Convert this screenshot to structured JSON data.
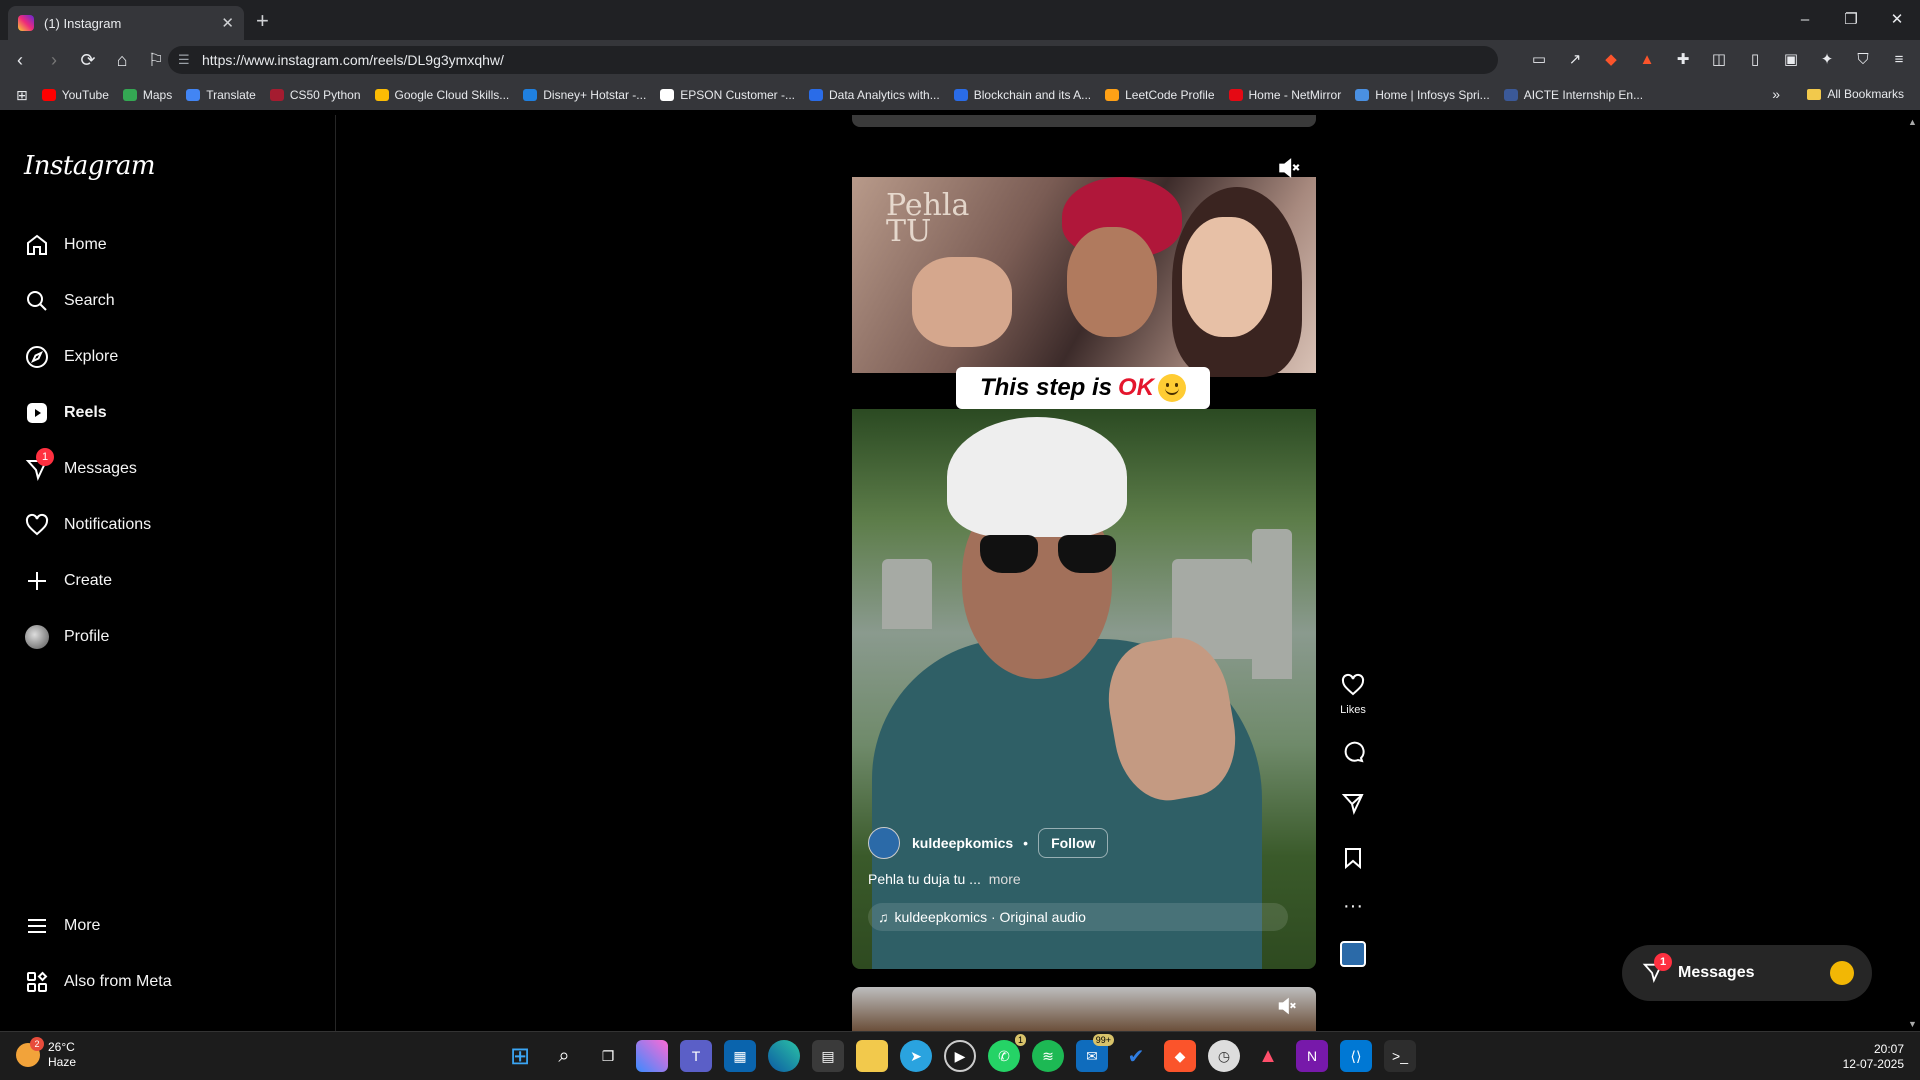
{
  "browser": {
    "tab_title": "(1) Instagram",
    "tab_close": "✕",
    "new_tab": "+",
    "url": "https://www.instagram.com/reels/DL9g3ymxqhw/",
    "window_controls": [
      "–",
      "❐",
      "✕"
    ]
  },
  "bookmarks": {
    "items": [
      {
        "label": "YouTube",
        "color": "#ff0000"
      },
      {
        "label": "Maps",
        "color": "#34a853"
      },
      {
        "label": "Translate",
        "color": "#4285f4"
      },
      {
        "label": "CS50 Python",
        "color": "#a51c30"
      },
      {
        "label": "Google Cloud Skills...",
        "color": "#fbbc04"
      },
      {
        "label": "Disney+ Hotstar -...",
        "color": "#1f80e0"
      },
      {
        "label": "EPSON Customer -...",
        "color": "#ffffff"
      },
      {
        "label": "Data Analytics with...",
        "color": "#2a6ce8"
      },
      {
        "label": "Blockchain and its A...",
        "color": "#2a6ce8"
      },
      {
        "label": "LeetCode Profile",
        "color": "#ffa116"
      },
      {
        "label": "Home - NetMirror",
        "color": "#e50914"
      },
      {
        "label": "Home | Infosys Spri...",
        "color": "#4a90e2"
      },
      {
        "label": "AICTE Internship En...",
        "color": "#3b5998"
      }
    ],
    "more": "»",
    "all_bookmarks": "All Bookmarks"
  },
  "sidebar": {
    "logo": "Instagram",
    "items": [
      {
        "label": "Home",
        "icon": "home-icon"
      },
      {
        "label": "Search",
        "icon": "search-icon"
      },
      {
        "label": "Explore",
        "icon": "compass-icon"
      },
      {
        "label": "Reels",
        "icon": "reels-icon"
      },
      {
        "label": "Messages",
        "icon": "messenger-icon",
        "badge": "1"
      },
      {
        "label": "Notifications",
        "icon": "heart-icon"
      },
      {
        "label": "Create",
        "icon": "plus-icon"
      },
      {
        "label": "Profile",
        "icon": "avatar-icon"
      }
    ],
    "more": "More",
    "also_from_meta": "Also from Meta"
  },
  "reel": {
    "song_overlay": "Pehla\nTU",
    "caption_text": "This step is",
    "caption_highlight": "OK",
    "username": "kuldeepkomics",
    "separator": "•",
    "follow": "Follow",
    "description": "Pehla tu duja tu ...",
    "more": "more",
    "audio": "kuldeepkomics · Original audio",
    "actions": {
      "likes_label": "Likes"
    }
  },
  "messages_pill": {
    "label": "Messages",
    "badge": "1"
  },
  "taskbar": {
    "weather_temp": "26°C",
    "weather_desc": "Haze",
    "weather_badge": "2",
    "whatsapp_badge": "1",
    "mail_badge": "99+",
    "time": "20:07",
    "date": "12-07-2025"
  }
}
